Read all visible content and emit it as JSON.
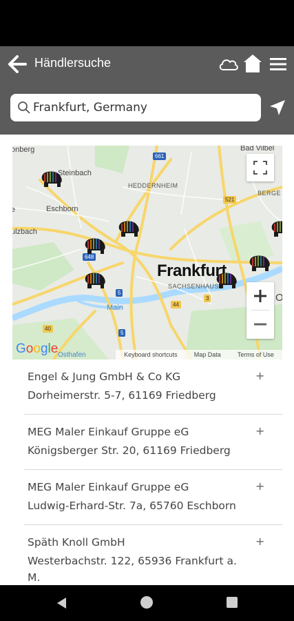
{
  "app_bar": {
    "title": "Händlersuche",
    "icons": [
      "back-arrow-icon",
      "cloud-icon",
      "home-icon",
      "menu-icon"
    ]
  },
  "search": {
    "value": "Frankfurt, Germany",
    "icon": "search-icon",
    "locate_icon": "location-arrow-icon"
  },
  "map": {
    "labels": {
      "bad_vilbel": "Bad Vilbel",
      "steinbach": "Steinbach",
      "eschborn": "Eschborn",
      "heddernheim": "HEDDERNHEIM",
      "berge": "BERGE",
      "frankfurt": "Frankfurt",
      "sachsenhausen": "SACHSENHAUS",
      "main": "Main",
      "sulzbach": "ulzbach",
      "oberg": "onberg",
      "hafen": "Osthafen",
      "e": "e",
      "e2": "Of"
    },
    "shields": {
      "s661": "661",
      "s521": "521",
      "s648": "648",
      "s5a": "5",
      "s5b": "5",
      "s44": "44",
      "s3": "3",
      "s40": "40"
    },
    "zoom_in": "+",
    "zoom_out": "−",
    "google": "Google",
    "attribution": {
      "shortcuts": "Keyboard shortcuts",
      "map_data": "Map Data",
      "terms": "Terms of Use"
    },
    "colors": {
      "road": "#f7d66b",
      "water": "#aadaff",
      "park": "#c9e6c0"
    }
  },
  "dealers": [
    {
      "name": "Engel & Jung GmbH & Co KG",
      "address": "Dorheimerstr. 5-7, 61169 Friedberg",
      "expand": "+"
    },
    {
      "name": "MEG Maler Einkauf Gruppe eG",
      "address": "Königsberger Str. 20, 61169 Friedberg",
      "expand": "+"
    },
    {
      "name": "MEG Maler Einkauf Gruppe eG",
      "address": "Ludwig-Erhard-Str. 7a, 65760 Eschborn",
      "expand": "+"
    },
    {
      "name": "Späth Knoll GmbH",
      "address": "Westerbachstr. 122, 65936 Frankfurt a. M.",
      "expand": "+"
    }
  ]
}
